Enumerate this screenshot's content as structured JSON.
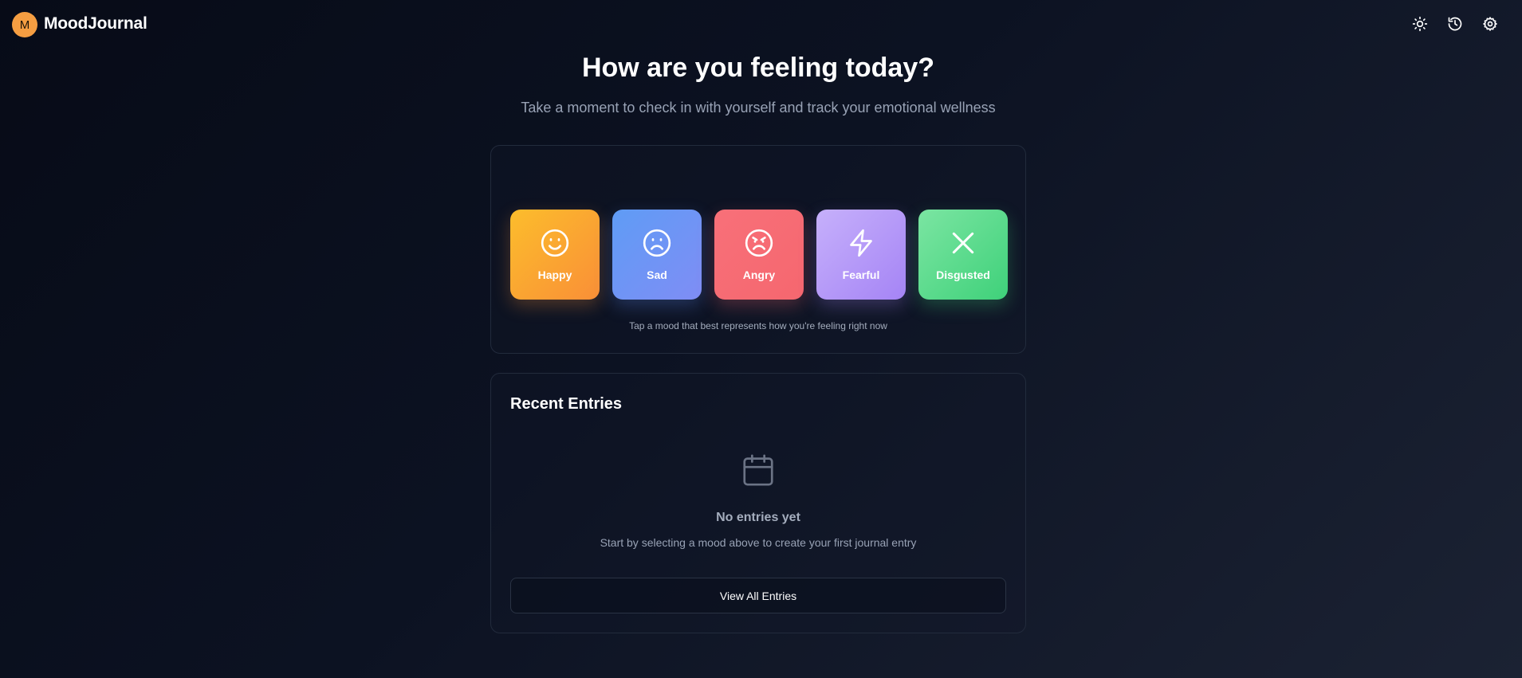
{
  "header": {
    "logo_letter": "M",
    "app_name": "MoodJournal",
    "icons": [
      "sun-icon",
      "history-icon",
      "gear-icon"
    ]
  },
  "hero": {
    "title": "How are you feeling today?",
    "subtitle": "Take a moment to check in with yourself and track your emotional wellness"
  },
  "moods": {
    "items": [
      {
        "label": "Happy",
        "icon": "smile-icon",
        "colors": [
          "#fcbd2c",
          "#f98f37"
        ]
      },
      {
        "label": "Sad",
        "icon": "frown-icon",
        "colors": [
          "#5f9cf5",
          "#7f8df5"
        ]
      },
      {
        "label": "Angry",
        "icon": "angry-icon",
        "colors": [
          "#f87079",
          "#f5676f"
        ]
      },
      {
        "label": "Fearful",
        "icon": "zap-icon",
        "colors": [
          "#c6b0fb",
          "#a584f5"
        ]
      },
      {
        "label": "Disgusted",
        "icon": "x-icon",
        "colors": [
          "#7be5a2",
          "#3fd17a"
        ]
      }
    ],
    "hint": "Tap a mood that best represents how you're feeling right now"
  },
  "entries": {
    "title": "Recent Entries",
    "empty_icon": "calendar-icon",
    "empty_title": "No entries yet",
    "empty_subtitle": "Start by selecting a mood above to create your first journal entry",
    "view_all_label": "View All Entries"
  },
  "colors": {
    "logo_badge": "#f59e42",
    "muted_text": "#98a2b5"
  }
}
